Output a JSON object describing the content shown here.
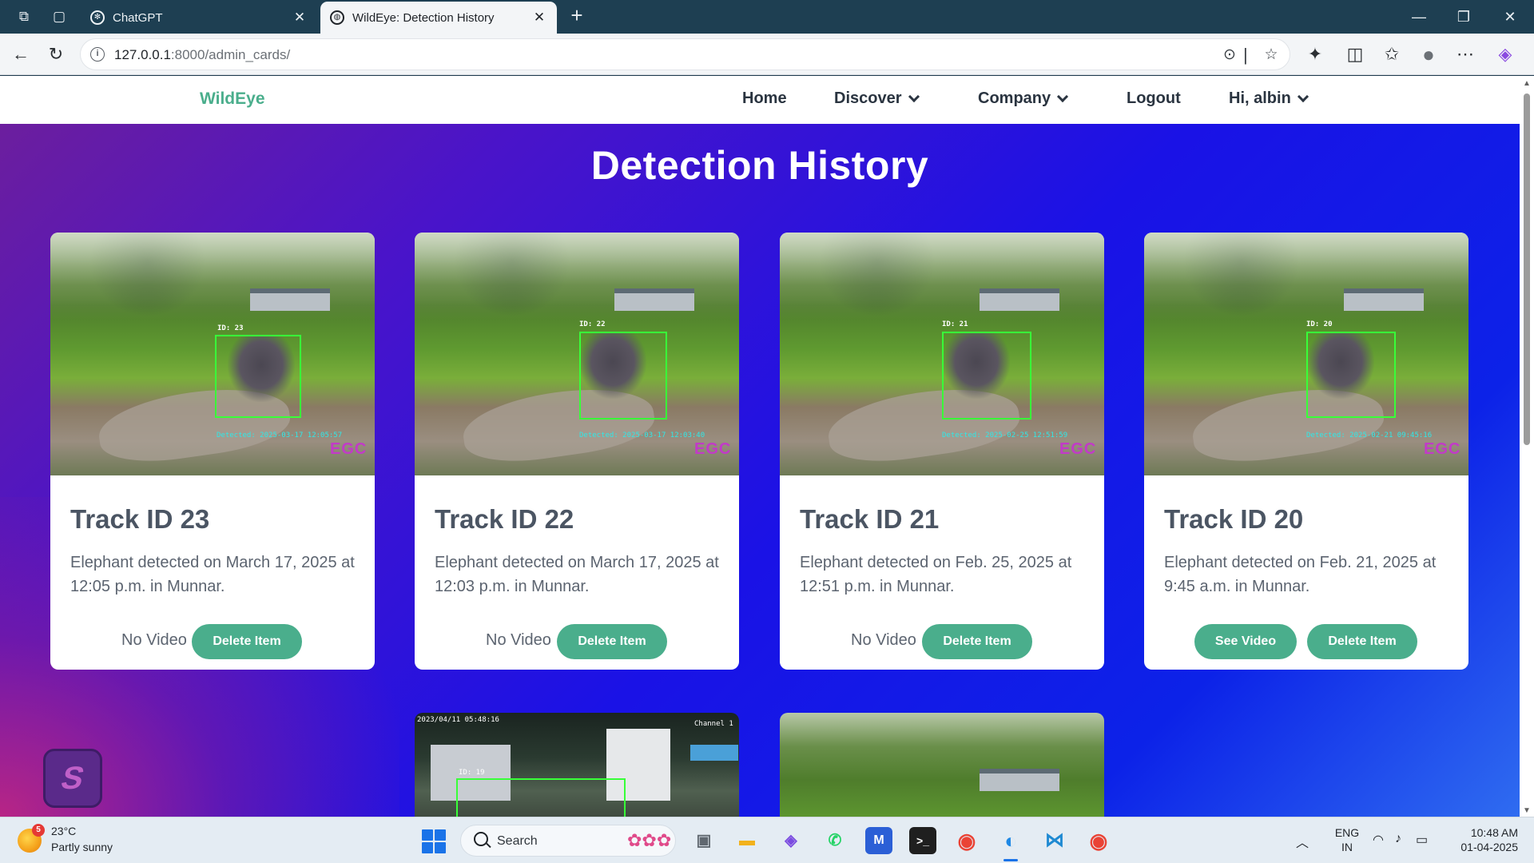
{
  "browser": {
    "tabs": [
      {
        "title": "ChatGPT",
        "active": false
      },
      {
        "title": "WildEye: Detection History",
        "active": true
      }
    ],
    "address": {
      "host": "127.0.0.1",
      "path": ":8000/admin_cards/"
    }
  },
  "navbar": {
    "brand": "WildEye",
    "items": [
      {
        "label": "Home",
        "dropdown": false
      },
      {
        "label": "Discover",
        "dropdown": true
      },
      {
        "label": "Company",
        "dropdown": true
      },
      {
        "label": "Logout",
        "dropdown": false
      },
      {
        "label": "Hi, albin",
        "dropdown": true
      }
    ]
  },
  "page": {
    "title": "Detection History",
    "cards": [
      {
        "title": "Track ID 23",
        "text": "Elephant detected on March 17, 2025 at 12:05 p.m. in Munnar.",
        "overlay_id": "ID: 23",
        "overlay_time": "Detected: 2025-03-17 12:05:57",
        "overlay_logo": "EGC",
        "video_label": "No Video",
        "has_video": false,
        "delete_label": "Delete Item"
      },
      {
        "title": "Track ID 22",
        "text": "Elephant detected on March 17, 2025 at 12:03 p.m. in Munnar.",
        "overlay_id": "ID: 22",
        "overlay_time": "Detected: 2025-03-17 12:03:40",
        "overlay_logo": "EGC",
        "video_label": "No Video",
        "has_video": false,
        "delete_label": "Delete Item"
      },
      {
        "title": "Track ID 21",
        "text": "Elephant detected on Feb. 25, 2025 at 12:51 p.m. in Munnar.",
        "overlay_id": "ID: 21",
        "overlay_time": "Detected: 2025-02-25 12:51:59",
        "overlay_logo": "EGC",
        "video_label": "No Video",
        "has_video": false,
        "delete_label": "Delete Item"
      },
      {
        "title": "Track ID 20",
        "text": "Elephant detected on Feb. 21, 2025 at 9:45 a.m. in Munnar.",
        "overlay_id": "ID: 20",
        "overlay_time": "Detected: 2025-02-21 09:45:16",
        "overlay_logo": "EGC",
        "video_label": "See Video",
        "has_video": true,
        "delete_label": "Delete Item"
      }
    ],
    "partial_cards": [
      {
        "overlay_time": "2023/04/11 05:48:16",
        "overlay_channel": "Channel 1",
        "overlay_id": "ID: 19"
      },
      {}
    ]
  },
  "taskbar": {
    "weather": {
      "badge": "5",
      "temp": "23°C",
      "desc": "Partly sunny"
    },
    "search_placeholder": "Search",
    "lang": {
      "line1": "ENG",
      "line2": "IN"
    },
    "clock": {
      "time": "10:48 AM",
      "date": "01-04-2025"
    }
  },
  "colors": {
    "accent": "#4aae8c",
    "nav_text": "#2a3440",
    "bbox": "#38ff38"
  }
}
